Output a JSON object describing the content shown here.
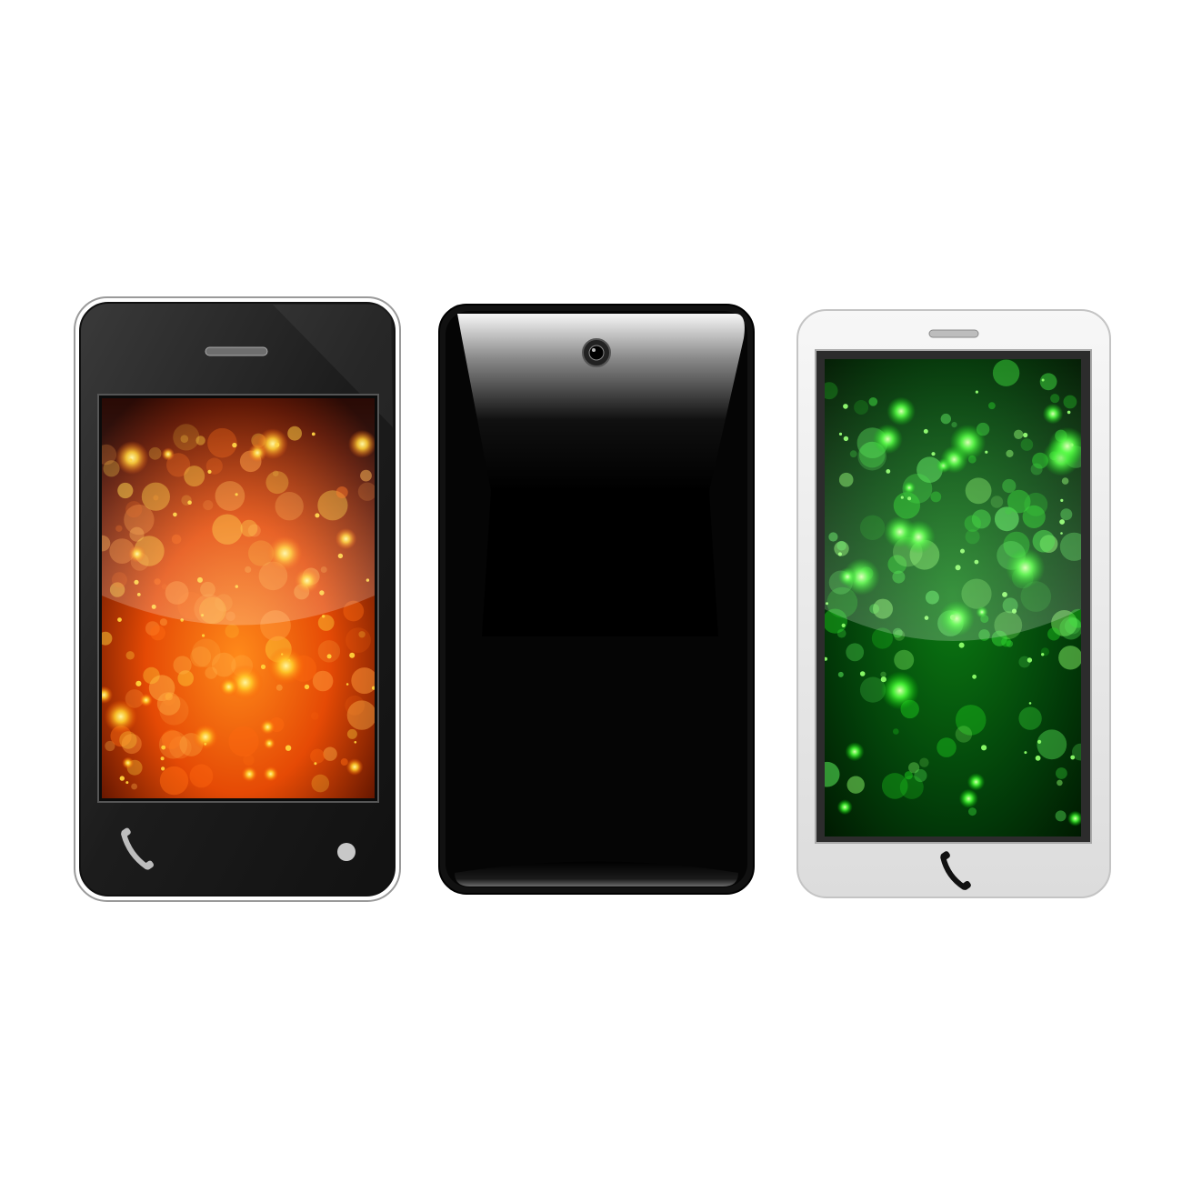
{
  "colors": {
    "background": "#ffffff",
    "phone_black_body": "#1a1a1a",
    "phone_black_face": "#2a2a2a",
    "phone_white_body": "#ececec",
    "screen_orange_core": "#ffd23a",
    "screen_orange_mid": "#ff6a10",
    "screen_orange_edge": "#3a0a00",
    "screen_green_core": "#8dff6a",
    "screen_green_mid": "#1fd01f",
    "screen_green_edge": "#001a00",
    "back_gloss": "#f4f4f4"
  },
  "phones": [
    {
      "name": "phone-front-black",
      "screen_theme": "orange",
      "icons": [
        "earpiece-icon",
        "phone-handset-icon",
        "home-dot-icon"
      ]
    },
    {
      "name": "phone-back-black",
      "icons": [
        "camera-lens-icon"
      ]
    },
    {
      "name": "phone-front-white",
      "screen_theme": "green",
      "icons": [
        "earpiece-icon",
        "phone-handset-icon"
      ]
    }
  ]
}
